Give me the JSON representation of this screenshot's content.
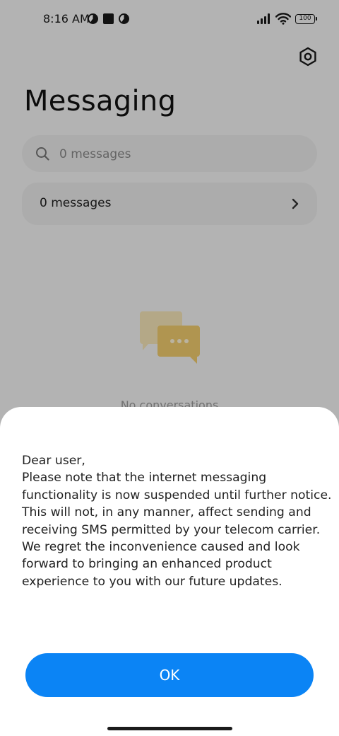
{
  "status_bar": {
    "time": "8:16 AM",
    "battery": "100",
    "icons": [
      "notification-pie-icon",
      "notification-square-icon",
      "notification-pie-icon",
      "signal-icon",
      "wifi-icon",
      "battery-icon"
    ]
  },
  "header": {
    "title": "Messaging",
    "settings_icon": "settings-hex-icon"
  },
  "search": {
    "placeholder": "0 messages",
    "value": ""
  },
  "messages_row": {
    "label": "0 messages"
  },
  "empty_state": {
    "text": "No conversations"
  },
  "dialog": {
    "greeting": "Dear user,",
    "message": "Please note that the internet messaging functionality is now suspended until further notice. This will not, in any manner, affect sending and receiving SMS permitted by your telecom carrier. We regret the inconvenience caused and look forward to bringing an enhanced product experience to you with our future updates.",
    "ok_label": "OK"
  },
  "colors": {
    "accent": "#0b84f5",
    "illustration": "#f1cc6e"
  }
}
